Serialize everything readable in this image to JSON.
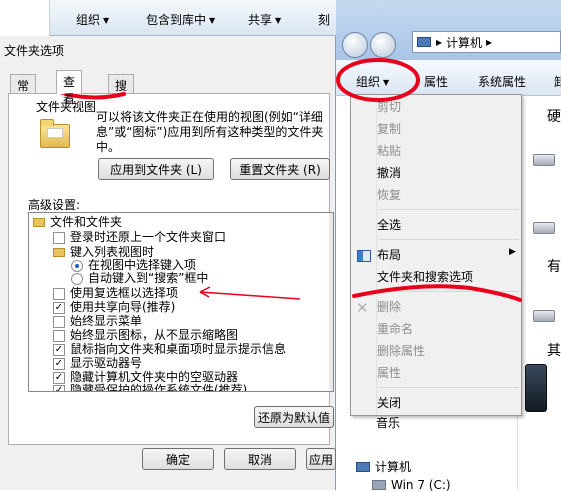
{
  "bg_toolbar": {
    "organize": "组织",
    "include_in_library": "包含到库中",
    "share": "共享",
    "burn": "刻"
  },
  "dialog": {
    "title": "文件夹选项",
    "tabs": [
      {
        "label": "常规"
      },
      {
        "label": "查看"
      },
      {
        "label": "搜索"
      }
    ],
    "folder_view_label": "文件夹视图",
    "folder_view_desc": "可以将该文件夹正在使用的视图(例如“详细\n息”或“图标”)应用到所有这种类型的文件夹\n中。",
    "apply_to_folders": "应用到文件夹 (L)",
    "reset_folders": "重置文件夹 (R)",
    "advanced_label": "高级设置:",
    "tree": [
      {
        "text": "文件和文件夹",
        "kind": "folder"
      },
      {
        "text": "登录时还原上一个文件夹窗口",
        "kind": "checkbox",
        "checked": false
      },
      {
        "text": "键入列表视图时",
        "kind": "folder"
      },
      {
        "text": "在视图中选择键入项",
        "kind": "radio",
        "checked": true
      },
      {
        "text": "自动键入到“搜索”框中",
        "kind": "radio",
        "checked": false
      },
      {
        "text": "使用复选框以选择项",
        "kind": "checkbox",
        "checked": false
      },
      {
        "text": "使用共享向导(推荐)",
        "kind": "checkbox",
        "checked": true
      },
      {
        "text": "始终显示菜单",
        "kind": "checkbox",
        "checked": false
      },
      {
        "text": "始终显示图标，从不显示缩略图",
        "kind": "checkbox",
        "checked": false
      },
      {
        "text": "鼠标指向文件夹和桌面项时显示提示信息",
        "kind": "checkbox",
        "checked": true
      },
      {
        "text": "显示驱动器号",
        "kind": "checkbox",
        "checked": true
      },
      {
        "text": "隐藏计算机文件夹中的空驱动器",
        "kind": "checkbox",
        "checked": true
      },
      {
        "text": "隐藏受保护的操作系统文件(推荐)",
        "kind": "checkbox",
        "checked": true
      }
    ],
    "restore_defaults": "还原为默认值",
    "ok": "确定",
    "cancel": "取消",
    "apply": "应用"
  },
  "explorer": {
    "breadcrumb": "计算机",
    "cmd_organize": "组织",
    "cmd_properties": "属性",
    "cmd_system_properties": "系统属性",
    "cmd_more": "卸",
    "right_labels": {
      "hard_disks": "硬",
      "removable": "有",
      "other": "其"
    },
    "nav_music": "音乐",
    "nav_computer": "计算机",
    "nav_drive": "Win 7 (C:)"
  },
  "context_menu": {
    "items": [
      {
        "label": "剪切",
        "disabled": true
      },
      {
        "label": "复制",
        "disabled": true
      },
      {
        "label": "粘贴",
        "disabled": true
      },
      {
        "label": "撤消",
        "disabled": false
      },
      {
        "label": "恢复",
        "disabled": true
      },
      {
        "label": "全选",
        "disabled": false
      },
      {
        "label": "布局",
        "disabled": false
      },
      {
        "label": "文件夹和搜索选项",
        "disabled": false
      },
      {
        "label": "删除",
        "disabled": true
      },
      {
        "label": "重命名",
        "disabled": true
      },
      {
        "label": "删除属性",
        "disabled": true
      },
      {
        "label": "属性",
        "disabled": true
      },
      {
        "label": "关闭",
        "disabled": false
      }
    ]
  },
  "annotation_color": "#e8001a"
}
